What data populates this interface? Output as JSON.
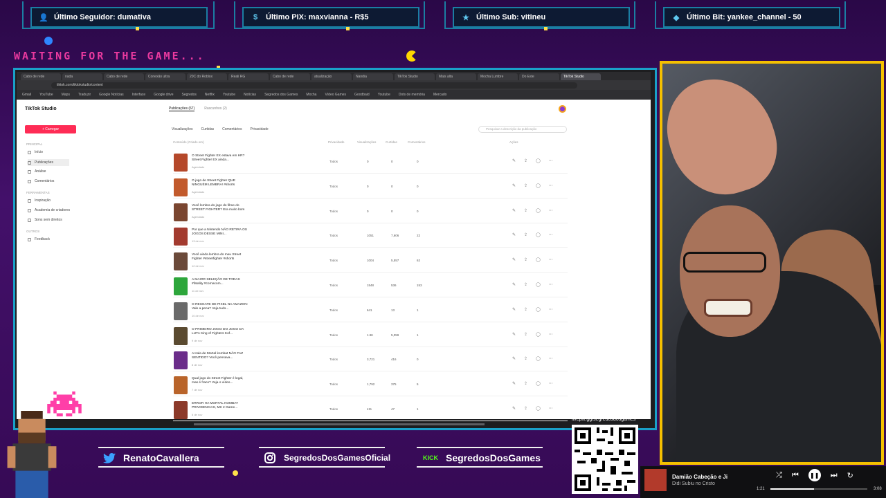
{
  "overlay": {
    "alerts": [
      {
        "icon": "user-icon",
        "label": "Último Seguidor: dumativa"
      },
      {
        "icon": "pix-icon",
        "label": "Último PIX: maxvianna - R$5"
      },
      {
        "icon": "star-icon",
        "label": "Último Sub: vitineu"
      },
      {
        "icon": "gem-icon",
        "label": "Último Bit: yankee_channel - 50"
      }
    ],
    "waiting_text": "WAITING FOR THE GAME...",
    "socials": [
      {
        "icon": "twitter-icon",
        "label": "RenatoCavallera"
      },
      {
        "icon": "instagram-icon",
        "label": "SegredosDosGamesOficial"
      },
      {
        "icon": "kick-icon",
        "prefix": "KICK",
        "label": "SegredosDosGames"
      }
    ],
    "qr_label": "livepix.gg/segredosdosgames"
  },
  "browser": {
    "tabs": [
      "Cabo de rede",
      "nada",
      "Cabo de rede",
      "Conexão ultra",
      "20C do Roblox",
      "Reali RG",
      "Cabo de rede",
      "atualização",
      "Nandia",
      "TikTok Studio",
      "Mais alta",
      "Mocha Lumbre",
      "Do Este",
      "TikTok Studio"
    ],
    "url": "tiktok.com/tiktokstudio/content",
    "bookmarks": [
      "Gmail",
      "YouTube",
      "Maps",
      "Traduzir",
      "Google Notícias",
      "Interface",
      "Google drive",
      "Segredos",
      "Netflix",
      "Youtube",
      "Notícias",
      "Segredos dos Games",
      "Mocha",
      "Vídeo Games",
      "Goodbaid",
      "Youtube",
      "Dots de memória",
      "Mercado"
    ]
  },
  "studio": {
    "logo": "TikTok Studio",
    "upload_label": "+ Carregar",
    "sections": [
      {
        "title": "PRINCIPAL",
        "items": [
          "Início",
          "Publicações",
          "Análise",
          "Comentários"
        ]
      },
      {
        "title": "FERRAMENTAS",
        "items": [
          "Inspiração",
          "Academia de criadores",
          "Sons sem direitos"
        ]
      },
      {
        "title": "OUTROS",
        "items": [
          "Feedback"
        ]
      }
    ],
    "page_tabs": [
      "Publicações (67)",
      "Rascunhos (2)"
    ],
    "filters": [
      "Visualizações",
      "Curtidas",
      "Comentários",
      "Privacidade"
    ],
    "search_placeholder": "Pesquisar a descrição da publicação",
    "columns": [
      "Conteúdo (Criado em)",
      "Privacidade",
      "Visualizações",
      "Curtidas",
      "Comentários",
      "Ações"
    ],
    "rows": [
      {
        "title": "O Street Fighter EX estava em HR? Street Fighter EX ainda...",
        "date": "Agendado",
        "privacy": "Todos",
        "views": "0",
        "likes": "0",
        "comments": "0",
        "color": "#b5482a"
      },
      {
        "title": "O jogo de Street Fighter QUE NINGUÉM LEMBRA! #shorts",
        "date": "Agendado",
        "privacy": "Todos",
        "views": "0",
        "likes": "0",
        "comments": "0",
        "color": "#c25a2c"
      },
      {
        "title": "Você lembra do jogo do filme do STREET FIGHTER? Era muito bom",
        "date": "Agendado",
        "privacy": "Todos",
        "views": "0",
        "likes": "0",
        "comments": "0",
        "color": "#7a4630"
      },
      {
        "title": "Por que a Nintendo NÃO RETIRA OS JOGOS DESSE MINI...",
        "date": "13 de nov",
        "privacy": "Todos",
        "views": "1051",
        "likes": "7,606",
        "comments": "22",
        "color": "#a33b2f"
      },
      {
        "title": "Você ainda lembra do meu Street Fighter #streetfighter #shorts",
        "date": "12 de nov",
        "privacy": "Todos",
        "views": "1004",
        "likes": "5,557",
        "comments": "62",
        "color": "#6b4a3a"
      },
      {
        "title": "A MAIOR SELEÇÃO DE TODAS #fatality #cornacom...",
        "date": "11 de nov",
        "privacy": "Todos",
        "views": "1548",
        "likes": "536",
        "comments": "153",
        "color": "#2da63b"
      },
      {
        "title": "O RESGATE DE PIXEL NA AMAZON: Vale a pena? Veja tudo...",
        "date": "10 de nov",
        "privacy": "Todos",
        "views": "641",
        "likes": "13",
        "comments": "1",
        "color": "#6a6a6a"
      },
      {
        "title": "O PRIMEIRO JOGO DO JOGO DA LUTA King of Fighters Kof...",
        "date": "9 de nov",
        "privacy": "Todos",
        "views": "1.9K",
        "likes": "5,059",
        "comments": "1",
        "color": "#5a4a30"
      },
      {
        "title": "A Kala de Mortal kombat NÃO FAZ SENTIDO? Você pensava...",
        "date": "8 de nov",
        "privacy": "Todos",
        "views": "3,721",
        "likes": "416",
        "comments": "0",
        "color": "#6b2d8a"
      },
      {
        "title": "Qual jogo do Street Fighter é legal, mas é fraco? Veja o vídeo...",
        "date": "7 de nov",
        "privacy": "Todos",
        "views": "1,792",
        "likes": "375",
        "comments": "5",
        "color": "#b9642a"
      },
      {
        "title": "ERROR HA MORTAL KOMBAT PRIVIDENCIAS, MK 2 Game...",
        "date": "6 de nov",
        "privacy": "Todos",
        "views": "411",
        "likes": "47",
        "comments": "1",
        "color": "#8c3a2a"
      }
    ]
  },
  "player": {
    "title": "Damião Cabeção e Ji",
    "artist": "Didi Subiu no Cristo",
    "time_elapsed": "1:21",
    "time_total": "3:08",
    "progress": 0.45
  }
}
